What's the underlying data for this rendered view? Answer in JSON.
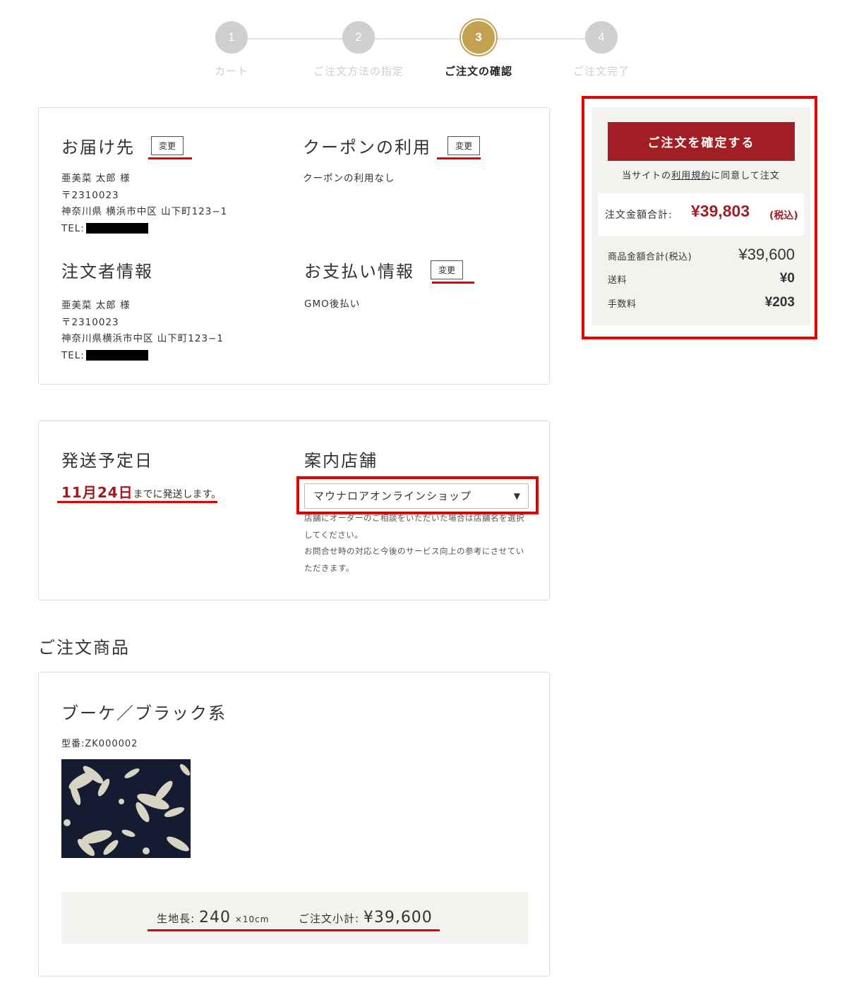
{
  "steps": [
    {
      "num": "1",
      "label": "カート"
    },
    {
      "num": "2",
      "label": "ご注文方法の指定"
    },
    {
      "num": "3",
      "label": "ご注文の確認"
    },
    {
      "num": "4",
      "label": "ご注文完了"
    }
  ],
  "delivery": {
    "title": "お届け先",
    "change": "変更",
    "name": "亜美菜 太郎 様",
    "zip": "〒2310023",
    "address": "神奈川県 横浜市中区 山下町123−1",
    "tel_label": "TEL:"
  },
  "coupon": {
    "title": "クーポンの利用",
    "change": "変更",
    "text": "クーポンの利用なし"
  },
  "orderer": {
    "title": "注文者情報",
    "name": "亜美菜 太郎 様",
    "zip": "〒2310023",
    "address": "神奈川県横浜市中区 山下町123−1",
    "tel_label": "TEL:"
  },
  "payment": {
    "title": "お支払い情報",
    "change": "変更",
    "method": "GMO後払い"
  },
  "shipping": {
    "title": "発送予定日",
    "date": "11月24日",
    "suffix": "までに発送します。"
  },
  "store": {
    "title": "案内店舗",
    "selected": "マウナロアオンラインショップ",
    "note1": "店舗にオーダーのご相談をいただいた場合は店舗名を選択してください。",
    "note2": "お問合せ時の対応と今後のサービス向上の参考にさせていただきます。"
  },
  "order_items": {
    "heading": "ご注文商品",
    "product_name": "ブーケ／ブラック系",
    "code": "型番:ZK000002",
    "length_label": "生地長:",
    "length_value": "240",
    "length_unit": "×10cm",
    "subtotal_label": "ご注文小計:",
    "subtotal_value": "¥39,600"
  },
  "summary": {
    "confirm_button": "ご注文を確定する",
    "agree_prefix": "当サイトの",
    "agree_link": "利用規約",
    "agree_suffix": "に同意して注文",
    "total_label": "注文金額合計:",
    "total_value": "¥39,803",
    "total_tax": "(税込)",
    "rows": [
      {
        "label": "商品金額合計(税込)",
        "value": "¥39,600"
      },
      {
        "label": "送料",
        "value": "¥0"
      },
      {
        "label": "手数料",
        "value": "¥203"
      }
    ]
  },
  "colors": {
    "accent_red": "#a11f24",
    "step_gold": "#c2a251",
    "annotation_red": "#e00000"
  }
}
